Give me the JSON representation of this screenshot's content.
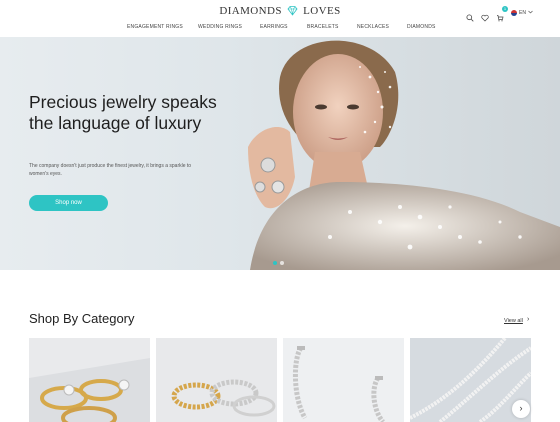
{
  "header": {
    "logo_left": "DIAMONDS",
    "logo_right": "LOVES",
    "cart_count": "1",
    "language": "EN"
  },
  "nav": [
    "ENGAGEMENT RINGS",
    "WEDDING RINGS",
    "EARRINGS",
    "BRACELETS",
    "NECKLACES",
    "DIAMONDS"
  ],
  "hero": {
    "title": "Precious jewelry speaks the language of luxury",
    "text": "The company doesn't just produce the finest jewelry, it brings a sparkle to women's eyes.",
    "button": "Shop now"
  },
  "categories": {
    "title": "Shop By Category",
    "view_all": "View all"
  },
  "colors": {
    "accent": "#2ec4c4"
  }
}
